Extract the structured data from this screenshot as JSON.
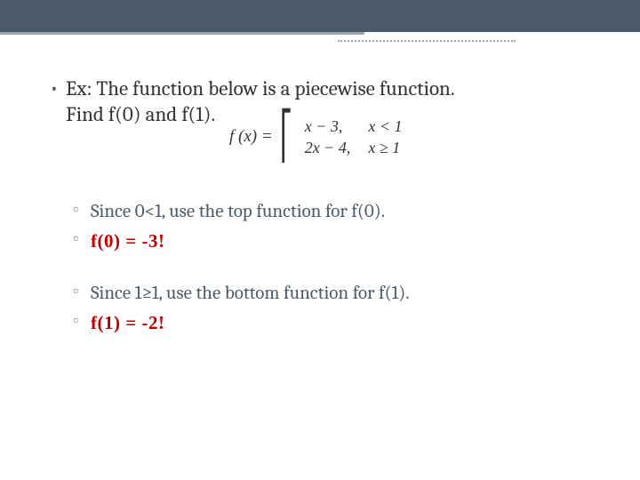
{
  "main": {
    "prompt_line1": "Ex:  The function below is a piecewise function.",
    "prompt_line2": "Find f(0) and f(1).",
    "equation": {
      "lhs": "f (x) =",
      "row1_expr": "x − 3,",
      "row1_cond": "x < 1",
      "row2_expr": "2x − 4,",
      "row2_cond": "x ≥ 1"
    },
    "steps": {
      "s1": "Since 0<1, use the top function for f(0).",
      "a1": "f(0) = -3!",
      "s2": "Since 1≥1, use the bottom function for f(1).",
      "a2": "f(1) = -2!"
    }
  }
}
